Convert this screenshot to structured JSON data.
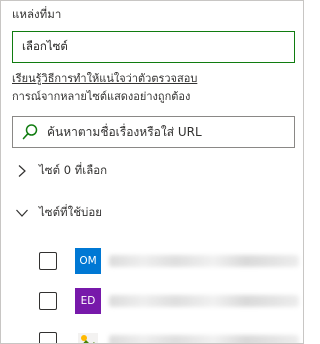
{
  "panel": {
    "section_label": "แหล่งที่มา",
    "site_input_value": "เลือกไซต์",
    "learn_line1": "เรียนรู้วิธีการทำให้แน่ใจว่าตัวตรวจสอบ",
    "learn_line2": "การณ์จากหลายไซต์แสดงอย่างถูกต้อง",
    "search_placeholder": "ค้นหาตามชื่อเรื่องหรือใส่ URL"
  },
  "groups": {
    "selected_label": "ไซต์ 0 ที่เลือก",
    "frequent_label": "ไซต์ที่ใช้บ่อย"
  },
  "sites": [
    {
      "initials": "OM",
      "color": "#0078d4"
    },
    {
      "initials": "ED",
      "color": "#7719aa"
    },
    {
      "initials": "",
      "color": "#ffffff"
    }
  ],
  "icons": {
    "search": "search-icon",
    "collapsed_chevron": "chevron-right-icon",
    "expanded_chevron": "chevron-down-icon"
  },
  "colors": {
    "input_border_active": "#107c10",
    "search_icon": "#107c10"
  }
}
